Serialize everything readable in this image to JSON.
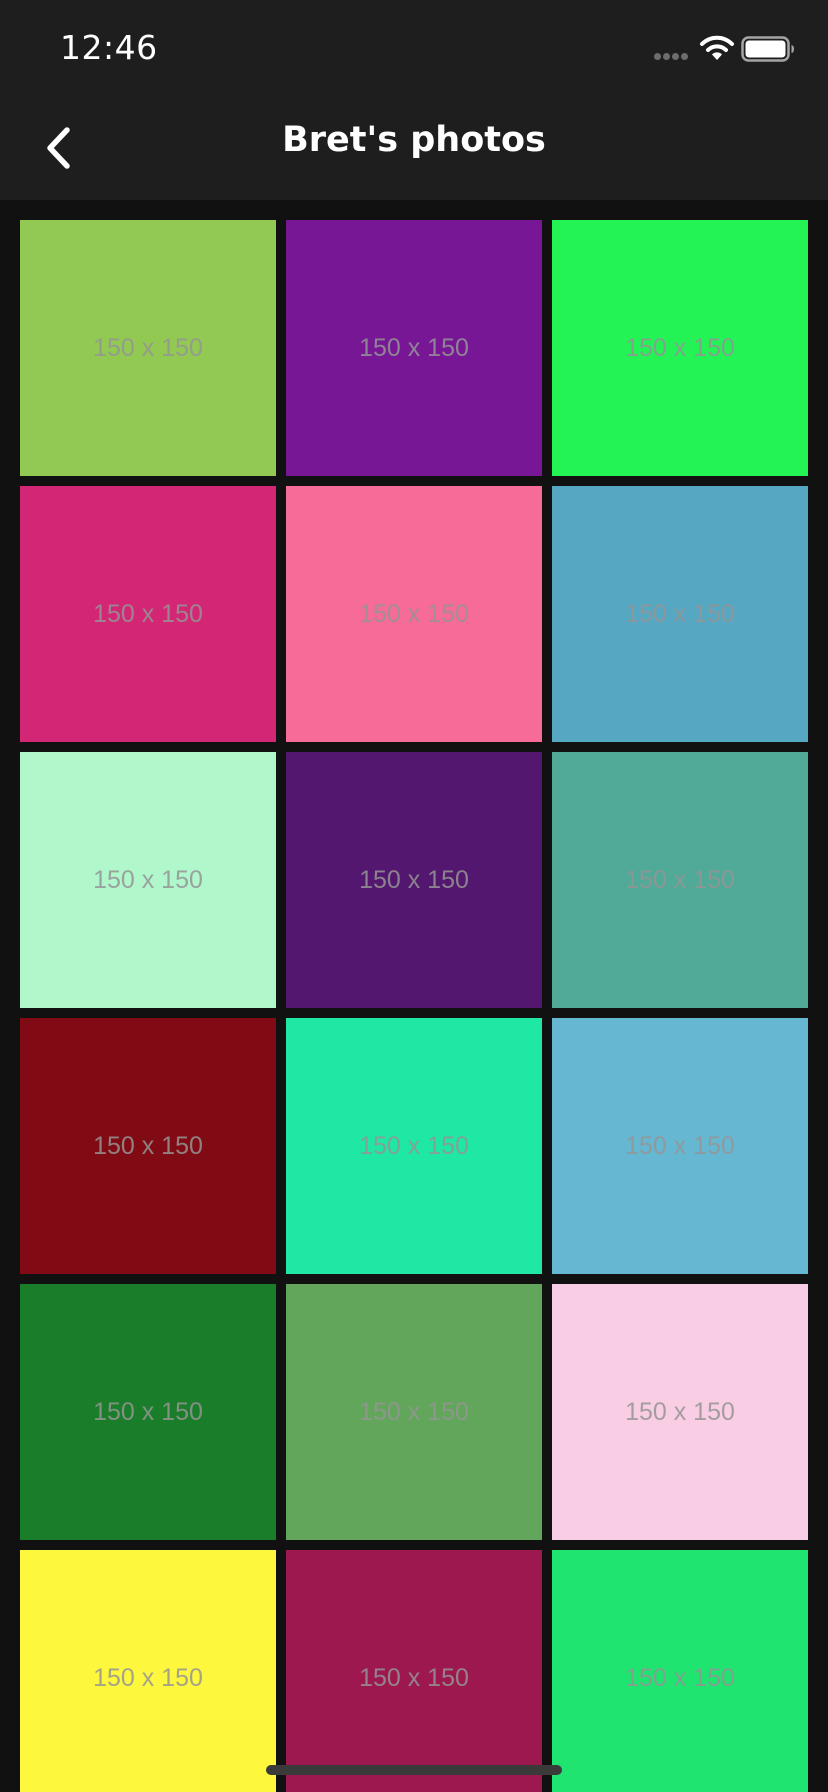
{
  "status_bar": {
    "time": "12:46",
    "signal_icon": "signal-dots-icon",
    "wifi_icon": "wifi-icon",
    "battery_icon": "battery-icon",
    "battery_level": 1.0
  },
  "nav_bar": {
    "back_icon": "chevron-left-icon",
    "title": "Bret's photos"
  },
  "photos": [
    {
      "label": "150 x 150",
      "color": "#92c952"
    },
    {
      "label": "150 x 150",
      "color": "#771796"
    },
    {
      "label": "150 x 150",
      "color": "#24f355"
    },
    {
      "label": "150 x 150",
      "color": "#d32776"
    },
    {
      "label": "150 x 150",
      "color": "#f66b97"
    },
    {
      "label": "150 x 150",
      "color": "#56a8c2"
    },
    {
      "label": "150 x 150",
      "color": "#b0f7cc"
    },
    {
      "label": "150 x 150",
      "color": "#54176f"
    },
    {
      "label": "150 x 150",
      "color": "#51aa97"
    },
    {
      "label": "150 x 150",
      "color": "#810b14"
    },
    {
      "label": "150 x 150",
      "color": "#1ee8a4"
    },
    {
      "label": "150 x 150",
      "color": "#66b7d2"
    },
    {
      "label": "150 x 150",
      "color": "#197d29"
    },
    {
      "label": "150 x 150",
      "color": "#61a65a"
    },
    {
      "label": "150 x 150",
      "color": "#f9cee5"
    },
    {
      "label": "150 x 150",
      "color": "#fdf73e"
    },
    {
      "label": "150 x 150",
      "color": "#9c184f"
    },
    {
      "label": "150 x 150",
      "color": "#1fe46f"
    }
  ],
  "colors": {
    "background": "#111111",
    "bar": "#1e1e1e",
    "text": "#ffffff",
    "placeholder_text": "#959595",
    "home_indicator": "#3a3a3a"
  }
}
